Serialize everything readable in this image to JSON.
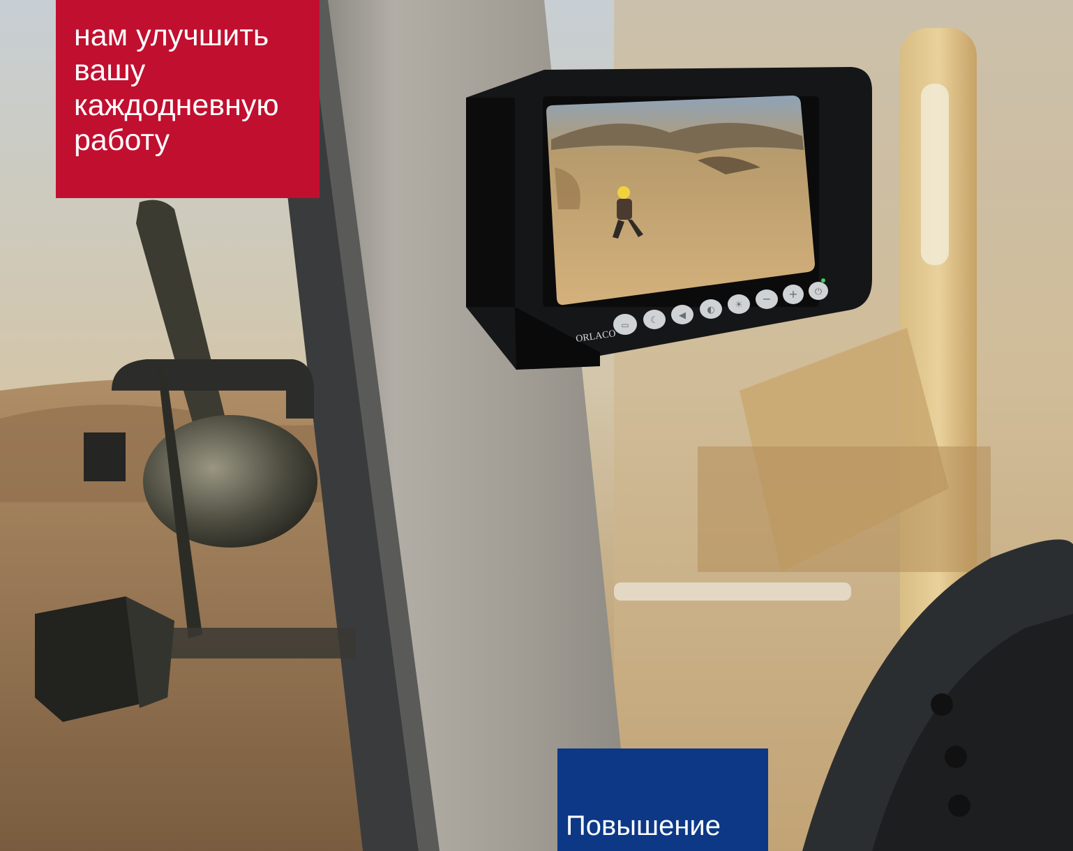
{
  "hero": {
    "headline_lines": [
      "нам улучшить",
      "вашу",
      "каждодневную",
      "работу"
    ],
    "colors": {
      "headline_bg": "#c10f2f",
      "caption_bg": "#0c3886",
      "text": "#ffffff"
    }
  },
  "monitor": {
    "brand": "ORLACO",
    "buttons": [
      "camera-switch-icon",
      "night-mode-icon",
      "volume-icon",
      "contrast-icon",
      "brightness-icon",
      "minus-icon",
      "plus-icon",
      "power-icon"
    ]
  },
  "caption": {
    "text": "Повышение"
  }
}
